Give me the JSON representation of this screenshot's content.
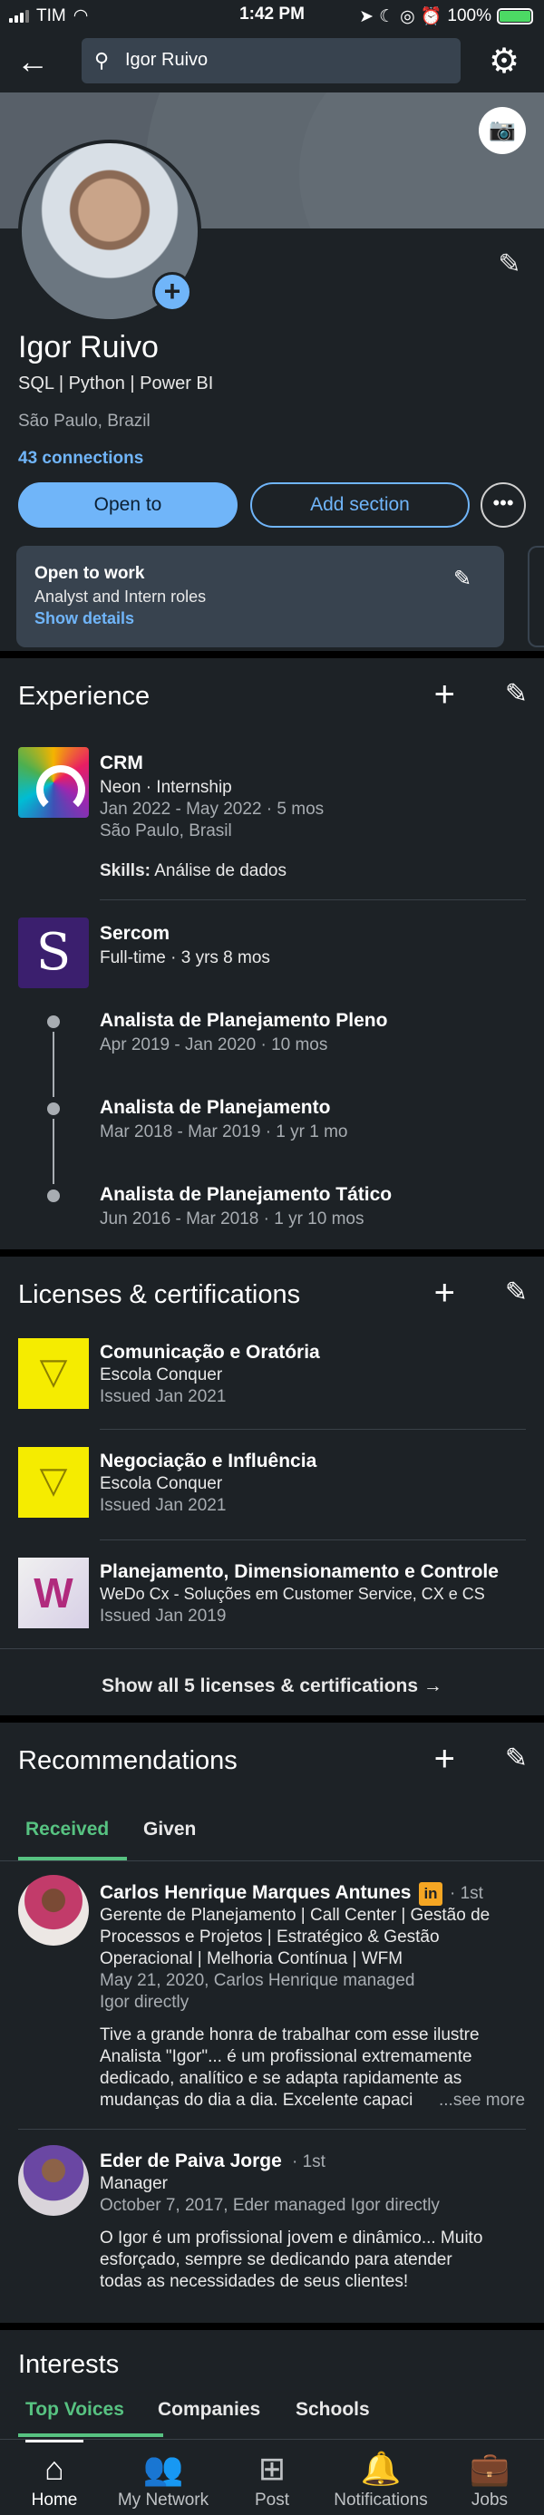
{
  "status_bar": {
    "carrier": "TIM",
    "time": "1:42 PM",
    "battery": "100%",
    "battery_level": 1.0
  },
  "header": {
    "search_value": "Igor Ruivo"
  },
  "profile": {
    "name": "Igor Ruivo",
    "headline": "SQL | Python | Power BI",
    "location": "São Paulo, Brazil",
    "connections": "43 connections",
    "open_to_label": "Open to",
    "add_section_label": "Add section",
    "more_label": "•••",
    "open_to_work": {
      "title": "Open to work",
      "subtitle": "Analyst and Intern roles",
      "link": "Show details"
    }
  },
  "experience": {
    "title": "Experience",
    "items": [
      {
        "role": "CRM",
        "company": "Neon · Internship",
        "dates": "Jan 2022 - May 2022 · 5 mos",
        "location": "São Paulo, Brasil",
        "skills_label": "Skills:",
        "skills": "Análise de dados"
      },
      {
        "company": "Sercom",
        "summary": "Full-time · 3 yrs 8 mos",
        "logo_letter": "S",
        "roles": [
          {
            "title": "Analista de Planejamento Pleno",
            "dates": "Apr 2019 - Jan 2020 · 10 mos"
          },
          {
            "title": "Analista de Planejamento",
            "dates": "Mar 2018 - Mar 2019 · 1 yr 1 mo"
          },
          {
            "title": "Analista de Planejamento Tático",
            "dates": "Jun 2016 - Mar 2018 · 1 yr 10 mos"
          }
        ]
      }
    ]
  },
  "licenses": {
    "title": "Licenses & certifications",
    "items": [
      {
        "name": "Comunicação e Oratória",
        "issuer": "Escola Conquer",
        "issued": "Issued Jan 2021"
      },
      {
        "name": "Negociação e Influência",
        "issuer": "Escola Conquer",
        "issued": "Issued Jan 2021"
      },
      {
        "name": "Planejamento, Dimensionamento e Controle",
        "issuer": "WeDo Cx - Soluções em Customer Service, CX e CS",
        "issued": "Issued Jan 2019"
      }
    ],
    "show_all": "Show all 5 licenses & certifications →"
  },
  "recommendations": {
    "title": "Recommendations",
    "tabs": [
      "Received",
      "Given"
    ],
    "items": [
      {
        "name": "Carlos Henrique Marques Antunes",
        "badge": "in",
        "degree": "· 1st",
        "headline_1": "Gerente de Planejamento | Call Center | Gestão de",
        "headline_2": "Processos e Projetos | Estratégico & Gestão",
        "headline_3": "Operacional | Melhoria Contínua | WFM",
        "meta_1": "May 21, 2020, Carlos Henrique managed",
        "meta_2": "Igor directly",
        "text_1": "Tive a grande honra de trabalhar com esse ilustre",
        "text_2": "Analista \"Igor\"... é um profissional extremamente",
        "text_3": "dedicado, analítico e se adapta rapidamente as",
        "text_4": "mudanças do dia a dia.  Excelente capaci",
        "see_more": "...see more"
      },
      {
        "name": "Eder de Paiva Jorge",
        "degree": "· 1st",
        "headline_1": "Manager",
        "meta_1": "October 7, 2017, Eder managed Igor directly",
        "text_1": "O Igor é um profissional jovem e dinâmico... Muito",
        "text_2": "esforçado, sempre se dedicando para atender",
        "text_3": "todas as necessidades de seus clientes!"
      }
    ]
  },
  "interests": {
    "title": "Interests",
    "tabs": [
      "Top Voices",
      "Companies",
      "Schools"
    ]
  },
  "bottom_nav": [
    "Home",
    "My Network",
    "Post",
    "Notifications",
    "Jobs"
  ]
}
